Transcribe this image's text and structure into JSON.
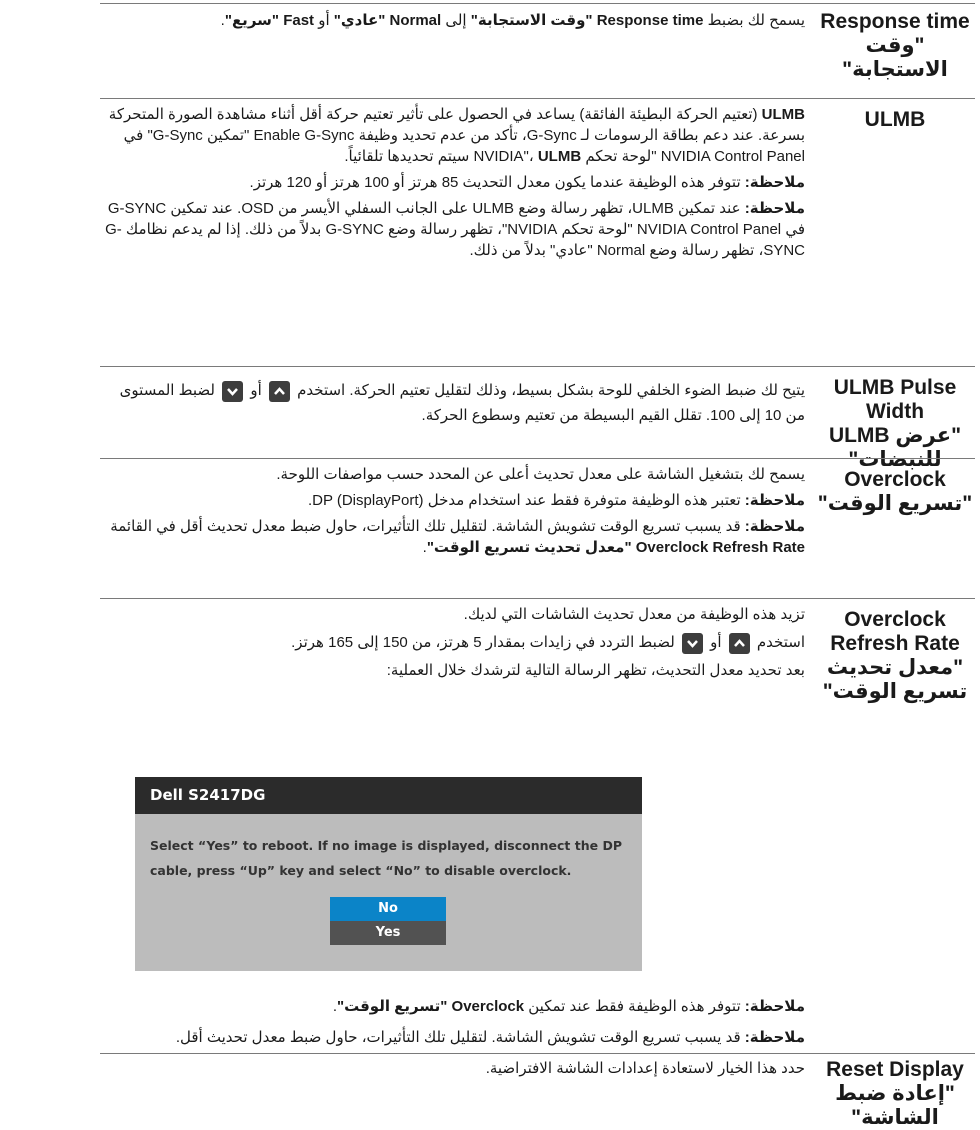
{
  "rows": {
    "response": {
      "label_en": "Response time",
      "label_ar": "\"وقت الاستجابة\"",
      "desc_html": "يسمح لك بضبط <b>Response time \"وقت الاستجابة\"</b> إلى <b>Normal \"عادي\"</b> أو <b>Fast \"سريع\"</b>."
    },
    "ulmb": {
      "label_en": "ULMB",
      "p1_html": "<b>ULMB</b> (تعتيم الحركة البطيئة الفائقة) يساعد في الحصول على تأثير تعتيم حركة أقل أثناء مشاهدة الصورة المتحركة بسرعة. عند دعم بطاقة الرسومات لـ G-Sync، تأكد من عدم تحديد وظيفة Enable G-Sync \"تمكين G-Sync\" في NVIDIA Control Panel \"لوحة تحكم NVIDIA\"، <b>ULMB</b> سيتم تحديدها تلقائياً.",
      "p2_html": "<b>ملاحظة:</b> تتوفر هذه الوظيفة عندما يكون معدل التحديث 85 هرتز أو 100 هرتز أو 120 هرتز.",
      "p3_html": "<b>ملاحظة:</b> عند تمكين ULMB، تظهر رسالة وضع ULMB على الجانب السفلي الأيسر من OSD. عند تمكين G-SYNC في NVIDIA Control Panel \"لوحة تحكم NVIDIA\"، تظهر رسالة وضع G-SYNC بدلاً من ذلك. إذا لم يدعم نظامك G-SYNC، تظهر رسالة وضع Normal \"عادي\" بدلاً من ذلك."
    },
    "pulse": {
      "label_en": "ULMB Pulse Width",
      "label_ar": "\"عرض ULMB للنبضات\"",
      "desc_a": "يتيح لك ضبط الضوء الخلفي للوحة بشكل بسيط، وذلك لتقليل تعتيم الحركة. استخدم",
      "desc_or": "أو",
      "desc_b": "لضبط المستوى من 10 إلى 100. تقلل القيم البسيطة من تعتيم وسطوع الحركة."
    },
    "overclock": {
      "label_en": "Overclock",
      "label_ar": "\"تسريع الوقت\"",
      "p1": "يسمح لك بتشغيل الشاشة على معدل تحديث أعلى عن المحدد حسب مواصفات اللوحة.",
      "p2_html": "<b>ملاحظة:</b> تعتبر هذه الوظيفة متوفرة فقط عند استخدام مدخل DP (DisplayPort).",
      "p3_html": "<b>ملاحظة:</b> قد يسبب تسريع الوقت تشويش الشاشة. لتقليل تلك التأثيرات، حاول ضبط معدل تحديث أقل في القائمة <b>Overclock Refresh Rate \"معدل تحديث تسريع الوقت\"</b>."
    },
    "refresh": {
      "label_en": "Overclock Refresh Rate",
      "label_ar": "\"معدل تحديث تسريع الوقت\"",
      "p1": "تزيد هذه الوظيفة من معدل تحديث الشاشات التي لديك.",
      "p2_a": "استخدم",
      "p2_or": "أو",
      "p2_b": "لضبط التردد في زايدات بمقدار 5 هرتز، من 150 إلى 165 هرتز.",
      "p3": "بعد تحديد معدل التحديث، تظهر الرسالة التالية لترشدك خلال العملية:",
      "dialog": {
        "title": "Dell S2417DG",
        "message": "Select “Yes” to reboot. If no image is displayed, disconnect the DP cable, press “Up” key and select “No” to disable overclock.",
        "no": "No",
        "yes": "Yes"
      },
      "note1_html": "<b>ملاحظة:</b> تتوفر هذه الوظيفة فقط عند تمكين <b>Overclock \"تسريع الوقت\"</b>.",
      "note2_html": "<b>ملاحظة:</b> قد يسبب تسريع الوقت تشويش الشاشة. لتقليل تلك التأثيرات، حاول ضبط معدل تحديث أقل."
    },
    "reset": {
      "label_en": "Reset Display",
      "label_ar": "\"إعادة ضبط الشاشة\"",
      "desc": "حدد هذا الخيار لاستعادة إعدادات الشاشة الافتراضية."
    }
  },
  "icons": {
    "up": "chevron-up-icon",
    "down": "chevron-down-icon",
    "button_color": "#3d3d3d"
  }
}
